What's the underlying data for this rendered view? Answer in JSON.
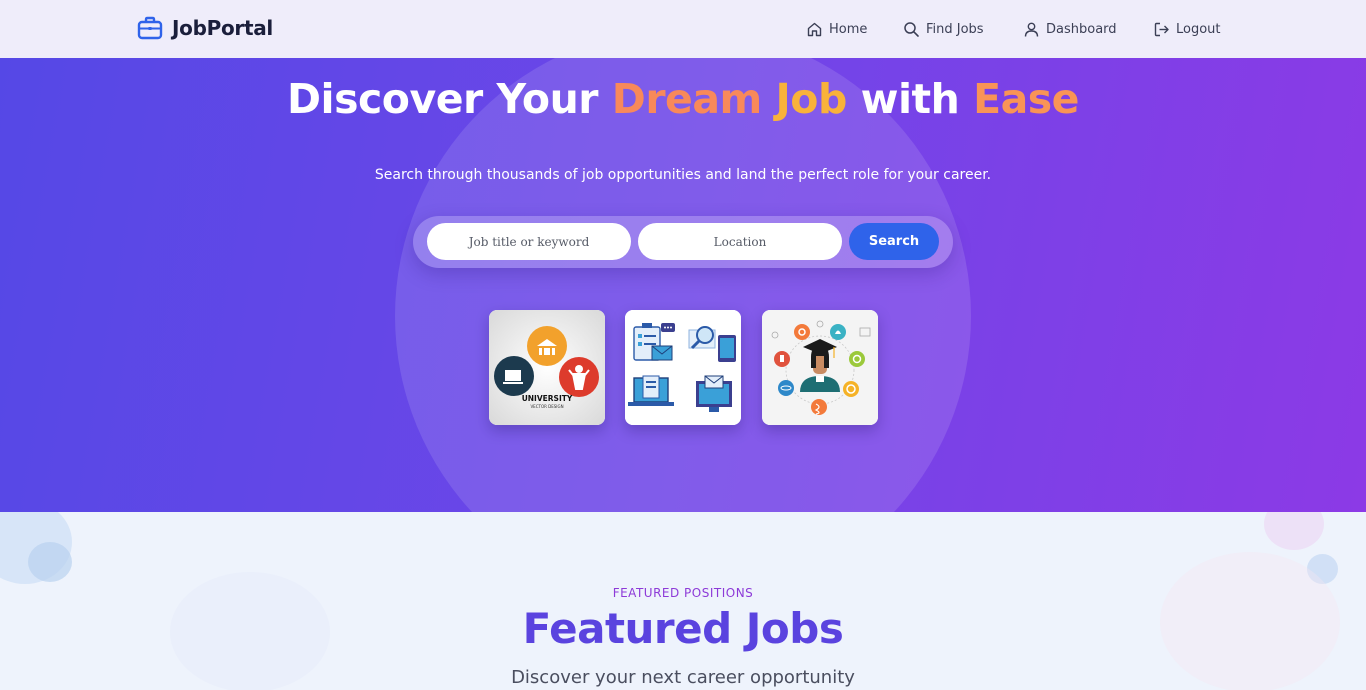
{
  "brand": {
    "name": "JobPortal",
    "icon": "briefcase-icon",
    "color": "#2f63ea"
  },
  "nav": {
    "items": [
      {
        "label": "Home",
        "icon": "home-icon"
      },
      {
        "label": "Find Jobs",
        "icon": "search-icon"
      },
      {
        "label": "Dashboard",
        "icon": "user-icon"
      },
      {
        "label": "Logout",
        "icon": "logout-icon"
      }
    ]
  },
  "hero": {
    "title_part1": "Discover Your ",
    "title_highlight1": "Dream ",
    "title_highlight2": "Job",
    "title_part2": " with ",
    "title_highlight3": "Ease",
    "subtitle": "Search through thousands of job opportunities and land the perfect role for your career.",
    "search": {
      "keyword_placeholder": "Job title or keyword",
      "location_placeholder": "Location",
      "button_label": "Search"
    },
    "cards": [
      {
        "icon": "university-illustration",
        "caption": "UNIVERSITY",
        "caption_sub": "VECTOR DESIGN"
      },
      {
        "icon": "office-communication-illustration"
      },
      {
        "icon": "graduate-science-illustration"
      }
    ],
    "colors": {
      "gradient_start": "#5548e6",
      "gradient_end": "#8c3ae6",
      "highlight_orange": "#f8895a",
      "highlight_yellow": "#f9b23a"
    }
  },
  "featured": {
    "eyebrow": "FEATURED POSITIONS",
    "title": "Featured Jobs",
    "subtitle": "Discover your next career opportunity"
  }
}
